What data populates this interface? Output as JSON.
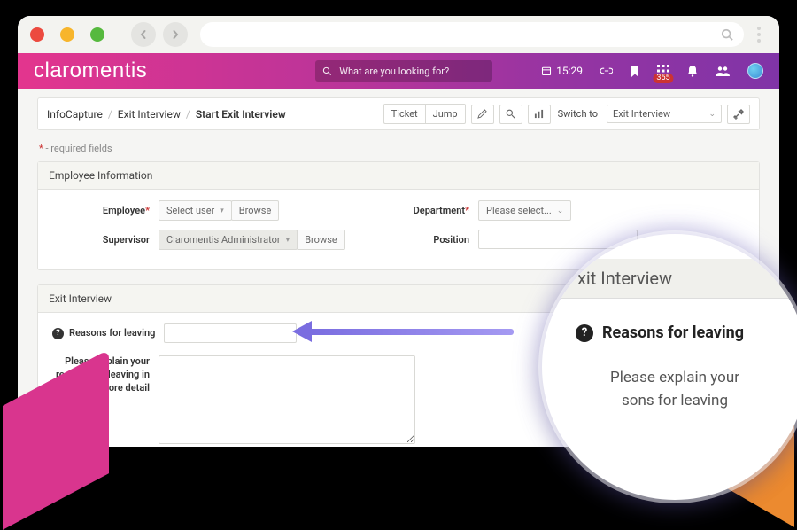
{
  "brand": "claromentis",
  "search": {
    "placeholder": "What are you looking for?"
  },
  "clock": "15:29",
  "badge_count": "355",
  "breadcrumb": {
    "root": "InfoCapture",
    "mid": "Exit Interview",
    "current": "Start Exit Interview"
  },
  "toolbar": {
    "ticket_label": "Ticket",
    "jump_label": "Jump",
    "switch_label": "Switch to",
    "switch_value": "Exit Interview"
  },
  "required_note_prefix": "*",
  "required_note_text": " - required fields",
  "panels": {
    "emp_info": {
      "title": "Employee Information",
      "employee_label": "Employee",
      "employee_placeholder": "Select user",
      "browse_label": "Browse",
      "supervisor_label": "Supervisor",
      "supervisor_value": "Claromentis Administrator",
      "department_label": "Department",
      "department_placeholder": "Please select...",
      "position_label": "Position"
    },
    "exit": {
      "title": "Exit Interview",
      "reasons_label": "Reasons for leaving",
      "detail_label": "Please explain your reasons for leaving in more detail"
    }
  },
  "magnifier": {
    "header": "xit Interview",
    "row1": "Reasons for leaving",
    "row2a": "Please explain your",
    "row2b": "sons for leaving"
  }
}
